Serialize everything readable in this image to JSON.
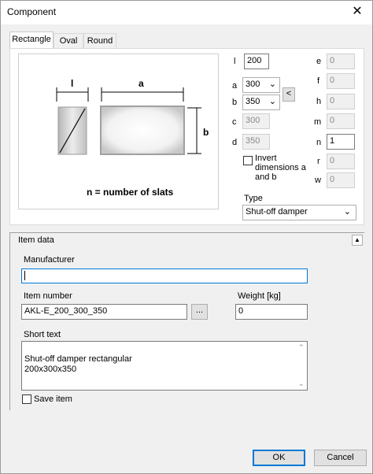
{
  "window": {
    "title": "Component",
    "close_symbol": "✕"
  },
  "tabs": [
    {
      "label": "Rectangle",
      "active": true
    },
    {
      "label": "Oval",
      "active": false
    },
    {
      "label": "Round",
      "active": false
    }
  ],
  "diagram": {
    "label_l": "l",
    "label_a": "a",
    "label_b": "b",
    "caption": "n = number of slats"
  },
  "dims": {
    "l": {
      "label": "l",
      "value": "200"
    },
    "a": {
      "label": "a",
      "value": "300"
    },
    "b": {
      "label": "b",
      "value": "350"
    },
    "c": {
      "label": "c",
      "value": "300"
    },
    "d": {
      "label": "d",
      "value": "350"
    },
    "swap_button": "<",
    "e": {
      "label": "e",
      "value": "0"
    },
    "f": {
      "label": "f",
      "value": "0"
    },
    "h": {
      "label": "h",
      "value": "0"
    },
    "m": {
      "label": "m",
      "value": "0"
    },
    "n": {
      "label": "n",
      "value": "1"
    },
    "r": {
      "label": "r",
      "value": "0"
    },
    "w": {
      "label": "w",
      "value": "0"
    }
  },
  "invert": {
    "label_line1": "Invert",
    "label_line2": "dimensions a",
    "label_line3": "and b",
    "checked": false
  },
  "type": {
    "label": "Type",
    "value": "Shut-off damper"
  },
  "item_data": {
    "header": "Item data",
    "collapse_symbol": "▲",
    "manufacturer_label": "Manufacturer",
    "manufacturer_value": "",
    "item_number_label": "Item number",
    "item_number_value": "AKL-E_200_300_350",
    "browse_button": "...",
    "weight_label": "Weight [kg]",
    "weight_value": "0",
    "short_text_label": "Short text",
    "short_text_value": "Shut-off damper rectangular\n200x300x350",
    "save_label": "Save item",
    "save_checked": false
  },
  "buttons": {
    "ok": "OK",
    "cancel": "Cancel"
  },
  "colors": {
    "focus_border": "#0078d7",
    "window_bg": "#f0f0f0"
  }
}
